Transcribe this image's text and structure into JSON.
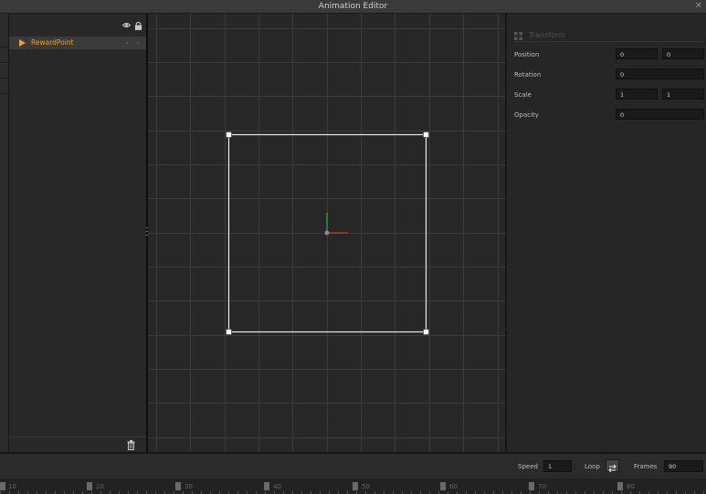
{
  "window": {
    "title": "Animation Editor"
  },
  "hierarchy": {
    "items": [
      {
        "name": "RewardPoint",
        "color": "#f0a11d"
      }
    ]
  },
  "properties": {
    "section_title": "Transform",
    "position": {
      "label": "Position",
      "x": "0",
      "y": "0"
    },
    "rotation": {
      "label": "Rotation",
      "value": "0"
    },
    "scale": {
      "label": "Scale",
      "x": "1",
      "y": "1"
    },
    "opacity": {
      "label": "Opacity",
      "value": "0"
    }
  },
  "playback": {
    "speed_label": "Speed",
    "speed_value": "1",
    "loop_label": "Loop",
    "frames_label": "Frames",
    "frames_value": "90"
  },
  "timeline": {
    "marks": [
      "10",
      "20",
      "30",
      "40",
      "50",
      "60",
      "70",
      "80"
    ]
  },
  "colors": {
    "accent": "#f0a11d",
    "axis_x": "#c0392b",
    "axis_y": "#2eaa3a"
  },
  "icons": {
    "visibility": "eye-icon",
    "lock": "lock-icon",
    "delete": "trash-icon",
    "close": "close-icon",
    "transform": "transform-grid-icon",
    "loop": "loop-icon"
  }
}
